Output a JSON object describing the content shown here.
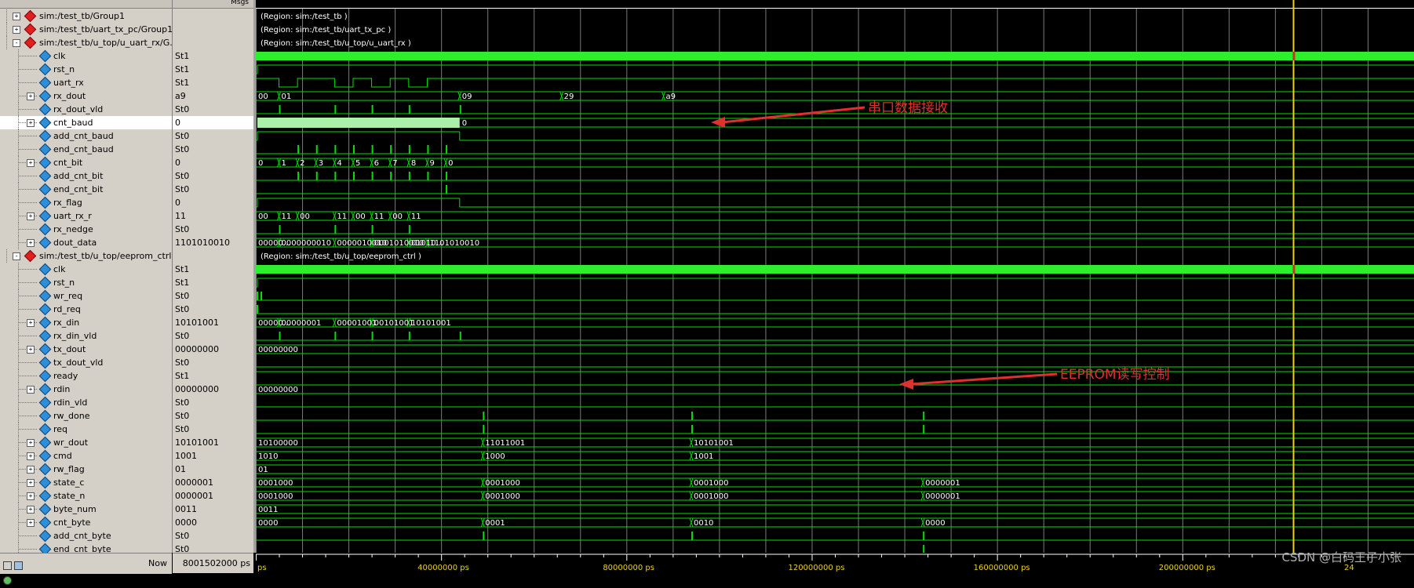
{
  "header": {
    "msgs_label": "Msgs"
  },
  "rows": [
    {
      "name": "sim:/test_tb/Group1",
      "value": "",
      "type": "group",
      "exp": "+",
      "indent": 0
    },
    {
      "name": "sim:/test_tb/uart_tx_pc/Group1",
      "value": "",
      "type": "group",
      "exp": "+",
      "indent": 0
    },
    {
      "name": "sim:/test_tb/u_top/u_uart_rx/G...",
      "value": "",
      "type": "group",
      "exp": "-",
      "indent": 0
    },
    {
      "name": "clk",
      "value": "St1",
      "type": "signal",
      "exp": "",
      "indent": 1
    },
    {
      "name": "rst_n",
      "value": "St1",
      "type": "signal",
      "exp": "",
      "indent": 1
    },
    {
      "name": "uart_rx",
      "value": "St1",
      "type": "signal",
      "exp": "",
      "indent": 1
    },
    {
      "name": "rx_dout",
      "value": "a9",
      "type": "signal",
      "exp": "+",
      "indent": 1
    },
    {
      "name": "rx_dout_vld",
      "value": "St0",
      "type": "signal",
      "exp": "",
      "indent": 1
    },
    {
      "name": "cnt_baud",
      "value": "0",
      "type": "signal",
      "exp": "+",
      "indent": 1,
      "selected": true
    },
    {
      "name": "add_cnt_baud",
      "value": "St0",
      "type": "signal",
      "exp": "",
      "indent": 1
    },
    {
      "name": "end_cnt_baud",
      "value": "St0",
      "type": "signal",
      "exp": "",
      "indent": 1
    },
    {
      "name": "cnt_bit",
      "value": "0",
      "type": "signal",
      "exp": "+",
      "indent": 1
    },
    {
      "name": "add_cnt_bit",
      "value": "St0",
      "type": "signal",
      "exp": "",
      "indent": 1
    },
    {
      "name": "end_cnt_bit",
      "value": "St0",
      "type": "signal",
      "exp": "",
      "indent": 1
    },
    {
      "name": "rx_flag",
      "value": "0",
      "type": "signal",
      "exp": "",
      "indent": 1
    },
    {
      "name": "uart_rx_r",
      "value": "11",
      "type": "signal",
      "exp": "+",
      "indent": 1
    },
    {
      "name": "rx_nedge",
      "value": "St0",
      "type": "signal",
      "exp": "",
      "indent": 1
    },
    {
      "name": "dout_data",
      "value": "1101010010",
      "type": "signal",
      "exp": "+",
      "indent": 1
    },
    {
      "name": "sim:/test_tb/u_top/eeprom_ctrl...",
      "value": "",
      "type": "group",
      "exp": "-",
      "indent": 0
    },
    {
      "name": "clk",
      "value": "St1",
      "type": "signal",
      "exp": "",
      "indent": 1
    },
    {
      "name": "rst_n",
      "value": "St1",
      "type": "signal",
      "exp": "",
      "indent": 1
    },
    {
      "name": "wr_req",
      "value": "St0",
      "type": "signal",
      "exp": "",
      "indent": 1
    },
    {
      "name": "rd_req",
      "value": "St0",
      "type": "signal",
      "exp": "",
      "indent": 1
    },
    {
      "name": "rx_din",
      "value": "10101001",
      "type": "signal",
      "exp": "+",
      "indent": 1
    },
    {
      "name": "rx_din_vld",
      "value": "St0",
      "type": "signal",
      "exp": "",
      "indent": 1
    },
    {
      "name": "tx_dout",
      "value": "00000000",
      "type": "signal",
      "exp": "+",
      "indent": 1
    },
    {
      "name": "tx_dout_vld",
      "value": "St0",
      "type": "signal",
      "exp": "",
      "indent": 1
    },
    {
      "name": "ready",
      "value": "St1",
      "type": "signal",
      "exp": "",
      "indent": 1
    },
    {
      "name": "rdin",
      "value": "00000000",
      "type": "signal",
      "exp": "+",
      "indent": 1
    },
    {
      "name": "rdin_vld",
      "value": "St0",
      "type": "signal",
      "exp": "",
      "indent": 1
    },
    {
      "name": "rw_done",
      "value": "St0",
      "type": "signal",
      "exp": "",
      "indent": 1
    },
    {
      "name": "req",
      "value": "St0",
      "type": "signal",
      "exp": "",
      "indent": 1
    },
    {
      "name": "wr_dout",
      "value": "10101001",
      "type": "signal",
      "exp": "+",
      "indent": 1
    },
    {
      "name": "cmd",
      "value": "1001",
      "type": "signal",
      "exp": "+",
      "indent": 1
    },
    {
      "name": "rw_flag",
      "value": "01",
      "type": "signal",
      "exp": "+",
      "indent": 1
    },
    {
      "name": "state_c",
      "value": "0000001",
      "type": "signal",
      "exp": "+",
      "indent": 1
    },
    {
      "name": "state_n",
      "value": "0000001",
      "type": "signal",
      "exp": "+",
      "indent": 1
    },
    {
      "name": "byte_num",
      "value": "0011",
      "type": "signal",
      "exp": "+",
      "indent": 1
    },
    {
      "name": "cnt_byte",
      "value": "0000",
      "type": "signal",
      "exp": "+",
      "indent": 1
    },
    {
      "name": "add_cnt_byte",
      "value": "St0",
      "type": "signal",
      "exp": "",
      "indent": 1
    },
    {
      "name": "end_cnt_byte",
      "value": "St0",
      "type": "signal",
      "exp": "",
      "indent": 1
    }
  ],
  "region_labels": [
    {
      "row": 0,
      "text": "(Region: sim:/test_tb )"
    },
    {
      "row": 1,
      "text": "(Region: sim:/test_tb/uart_tx_pc )"
    },
    {
      "row": 2,
      "text": "(Region: sim:/test_tb/u_top/u_uart_rx )"
    },
    {
      "row": 18,
      "text": "(Region: sim:/test_tb/u_top/eeprom_ctrl )"
    }
  ],
  "bus_labels": [
    {
      "row": 6,
      "items": [
        {
          "t": 0,
          "text": "00"
        },
        {
          "t": 5000000,
          "text": "01"
        },
        {
          "t": 44000000,
          "text": "09"
        },
        {
          "t": 66000000,
          "text": "29"
        },
        {
          "t": 88000000,
          "text": "a9"
        }
      ]
    },
    {
      "row": 11,
      "items": [
        {
          "t": 0,
          "text": "0"
        },
        {
          "t": 5000000,
          "text": "1"
        },
        {
          "t": 9000000,
          "text": "2"
        },
        {
          "t": 13000000,
          "text": "3"
        },
        {
          "t": 17000000,
          "text": "4"
        },
        {
          "t": 21000000,
          "text": "5"
        },
        {
          "t": 25000000,
          "text": "6"
        },
        {
          "t": 29000000,
          "text": "7"
        },
        {
          "t": 33000000,
          "text": "8"
        },
        {
          "t": 37000000,
          "text": "9"
        },
        {
          "t": 41000000,
          "text": "0"
        }
      ]
    },
    {
      "row": 15,
      "items": [
        {
          "t": 0,
          "text": "00"
        },
        {
          "t": 5000000,
          "text": "11"
        },
        {
          "t": 9000000,
          "text": "00"
        },
        {
          "t": 17000000,
          "text": "11"
        },
        {
          "t": 21000000,
          "text": "00"
        },
        {
          "t": 25000000,
          "text": "11"
        },
        {
          "t": 29000000,
          "text": "00"
        },
        {
          "t": 33000000,
          "text": "11"
        }
      ]
    },
    {
      "row": 17,
      "items": [
        {
          "t": 0,
          "text": "00000..."
        },
        {
          "t": 5000000,
          "text": "0000000010"
        },
        {
          "t": 17000000,
          "text": "0000010010"
        },
        {
          "t": 25000000,
          "text": "0001010010"
        },
        {
          "t": 33000000,
          "text": "01010..."
        },
        {
          "t": 37000000,
          "text": "1101010010"
        }
      ]
    },
    {
      "row": 23,
      "items": [
        {
          "t": 0,
          "text": "00000..."
        },
        {
          "t": 5000000,
          "text": "00000001"
        },
        {
          "t": 17000000,
          "text": "00001001"
        },
        {
          "t": 25000000,
          "text": "00101001"
        },
        {
          "t": 33000000,
          "text": "10101001"
        }
      ]
    },
    {
      "row": 25,
      "items": [
        {
          "t": 0,
          "text": "00000000"
        }
      ]
    },
    {
      "row": 28,
      "items": [
        {
          "t": 0,
          "text": "00000000"
        }
      ]
    },
    {
      "row": 32,
      "items": [
        {
          "t": 0,
          "text": "10100000"
        },
        {
          "t": 49000000,
          "text": "11011001"
        },
        {
          "t": 94000000,
          "text": "10101001"
        }
      ]
    },
    {
      "row": 33,
      "items": [
        {
          "t": 0,
          "text": "1010"
        },
        {
          "t": 49000000,
          "text": "1000"
        },
        {
          "t": 94000000,
          "text": "1001"
        }
      ]
    },
    {
      "row": 34,
      "items": [
        {
          "t": 0,
          "text": "01"
        }
      ]
    },
    {
      "row": 35,
      "items": [
        {
          "t": 0,
          "text": "0001000"
        },
        {
          "t": 49000000,
          "text": "0001000"
        },
        {
          "t": 94000000,
          "text": "0001000"
        },
        {
          "t": 144000000,
          "text": "0000001"
        }
      ]
    },
    {
      "row": 36,
      "items": [
        {
          "t": 0,
          "text": "0001000"
        },
        {
          "t": 49000000,
          "text": "0001000"
        },
        {
          "t": 94000000,
          "text": "0001000"
        },
        {
          "t": 144000000,
          "text": "0000001"
        }
      ]
    },
    {
      "row": 37,
      "items": [
        {
          "t": 0,
          "text": "0011"
        }
      ]
    },
    {
      "row": 38,
      "items": [
        {
          "t": 0,
          "text": "0000"
        },
        {
          "t": 49000000,
          "text": "0001"
        },
        {
          "t": 94000000,
          "text": "0010"
        },
        {
          "t": 144000000,
          "text": "0000"
        }
      ]
    }
  ],
  "cnt_baud_end_label": "0",
  "annotations": [
    {
      "text": "串口数据接收",
      "row": 7
    },
    {
      "text": "EEPROM读写控制",
      "row": 27
    }
  ],
  "timebar": {
    "now_label": "Now",
    "now_value": "8001502000 ps",
    "ticks": [
      {
        "t": 0,
        "text": "ps"
      },
      {
        "t": 40000000,
        "text": "40000000 ps"
      },
      {
        "t": 80000000,
        "text": "80000000 ps"
      },
      {
        "t": 120000000,
        "text": "120000000 ps"
      },
      {
        "t": 160000000,
        "text": "160000000 ps"
      },
      {
        "t": 200000000,
        "text": "200000000 ps"
      },
      {
        "t": 240000000,
        "text": "24"
      }
    ]
  },
  "cursor_t": 224000000,
  "time_range_ps": [
    0,
    250000000
  ],
  "colors": {
    "wave": "#00e000",
    "bright": "#2cf02c",
    "grid": "#7a7a7a",
    "cursor": "#e8d020",
    "accent": "#e03030"
  },
  "watermark": "CSDN @白码王子小张"
}
